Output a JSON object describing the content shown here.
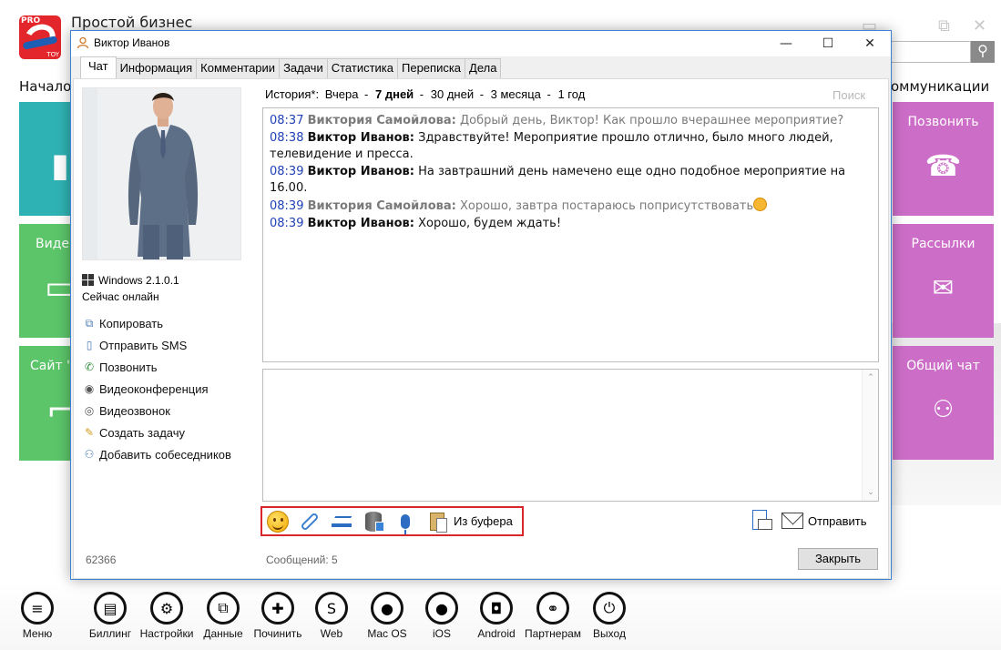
{
  "app": {
    "title": "Простой бизнес",
    "logo_pro": "PRO",
    "logo_toy": "TOY",
    "nav_left": "Начало",
    "nav_right": "оммуникации",
    "tiles_right": [
      {
        "label": "Позвонить",
        "icon": "phone-icon"
      },
      {
        "label": "Рассылки",
        "icon": "mailing-icon"
      },
      {
        "label": "Общий чат",
        "icon": "group-chat-icon"
      }
    ],
    "tiles_left": [
      {
        "label": "",
        "icon": "partial-tile"
      },
      {
        "label": "Виде",
        "icon": "video-icon"
      },
      {
        "label": "Сайт \"",
        "icon": "site-icon"
      }
    ]
  },
  "bottom_bar": [
    {
      "label": "Меню",
      "icon": "menu-icon"
    },
    {
      "label": "Биллинг",
      "icon": "billing-icon"
    },
    {
      "label": "Настройки",
      "icon": "settings-icon"
    },
    {
      "label": "Данные",
      "icon": "data-icon"
    },
    {
      "label": "Починить",
      "icon": "repair-icon"
    },
    {
      "label": "Web",
      "icon": "web-icon"
    },
    {
      "label": "Mac OS",
      "icon": "apple-icon"
    },
    {
      "label": "iOS",
      "icon": "apple-icon"
    },
    {
      "label": "Android",
      "icon": "android-icon"
    },
    {
      "label": "Партнерам",
      "icon": "handshake-icon"
    },
    {
      "label": "Выход",
      "icon": "power-icon"
    }
  ],
  "dialog": {
    "title": "Виктор Иванов",
    "tabs": [
      "Чат",
      "Информация",
      "Комментарии",
      "Задачи",
      "Статистика",
      "Переписка",
      "Дела"
    ],
    "active_tab": "Чат",
    "contact": {
      "os": "Windows 2.1.0.1",
      "status": "Сейчас онлайн"
    },
    "actions": [
      {
        "label": "Копировать",
        "icon": "copy-icon"
      },
      {
        "label": "Отправить SMS",
        "icon": "sms-icon"
      },
      {
        "label": "Позвонить",
        "icon": "phone-icon"
      },
      {
        "label": "Видеоконференция",
        "icon": "videoconference-icon"
      },
      {
        "label": "Видеозвонок",
        "icon": "webcam-icon"
      },
      {
        "label": "Создать задачу",
        "icon": "task-icon"
      },
      {
        "label": "Добавить собеседников",
        "icon": "add-people-icon"
      }
    ],
    "history": {
      "label": "История*:",
      "options": [
        "Вчера",
        "7 дней",
        "30 дней",
        "3 месяца",
        "1 год"
      ],
      "selected": "7 дней",
      "search": "Поиск"
    },
    "messages": [
      {
        "time": "08:37",
        "author": "Виктория Самойлова:",
        "text": "Добрый день, Виктор! Как прошло вчерашнее мероприятие?",
        "direction": "in"
      },
      {
        "time": "08:38",
        "author": "Виктор Иванов:",
        "text": "Здравствуйте! Мероприятие прошло отлично, было много людей, телевидение и пресса.",
        "direction": "out"
      },
      {
        "time": "08:39",
        "author": "Виктор Иванов:",
        "text": "На завтрашний день намечено еще одно подобное мероприятие на 16.00.",
        "direction": "out"
      },
      {
        "time": "08:39",
        "author": "Виктория Самойлова:",
        "text": "Хорошо, завтра постараюсь поприсутствовать",
        "direction": "in",
        "emoji": true
      },
      {
        "time": "08:39",
        "author": "Виктор Иванов:",
        "text": "Хорошо, будем ждать!",
        "direction": "out"
      }
    ],
    "compose_value": "",
    "toolbar": {
      "paste_label": "Из буфера",
      "send_label": "Отправить"
    },
    "footer": {
      "id": "62366",
      "messages_count": "Сообщений: 5",
      "close_label": "Закрыть"
    }
  },
  "colors": {
    "accent_blue": "#1f3fb5",
    "highlight_red": "#d9262b",
    "tile_teal": "#2fb2b3",
    "tile_green": "#5cc56a",
    "tile_pink": "#cc6ec8"
  }
}
